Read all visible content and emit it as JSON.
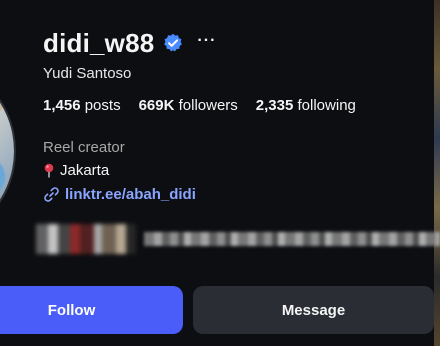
{
  "profile": {
    "username": "didi_w88",
    "verified_icon": "verified-badge-icon",
    "more_icon": "more-options-icon",
    "more_glyph": "···",
    "full_name": "Yudi Santoso",
    "stats": {
      "posts_count": "1,456",
      "posts_label": " posts",
      "followers_count": "669K",
      "followers_label": " followers",
      "following_count": "2,335",
      "following_label": " following"
    },
    "category": "Reel creator",
    "location": "Jakarta",
    "link": "linktr.ee/abah_didi"
  },
  "actions": {
    "follow_label": "Follow",
    "message_label": "Message"
  },
  "colors": {
    "background": "#0c0e11",
    "verified_blue": "#4a8cff",
    "follow_button": "#4a5df9",
    "message_button": "#2a2d33",
    "link": "#8aa4ff",
    "muted_text": "#a8a8a8"
  }
}
